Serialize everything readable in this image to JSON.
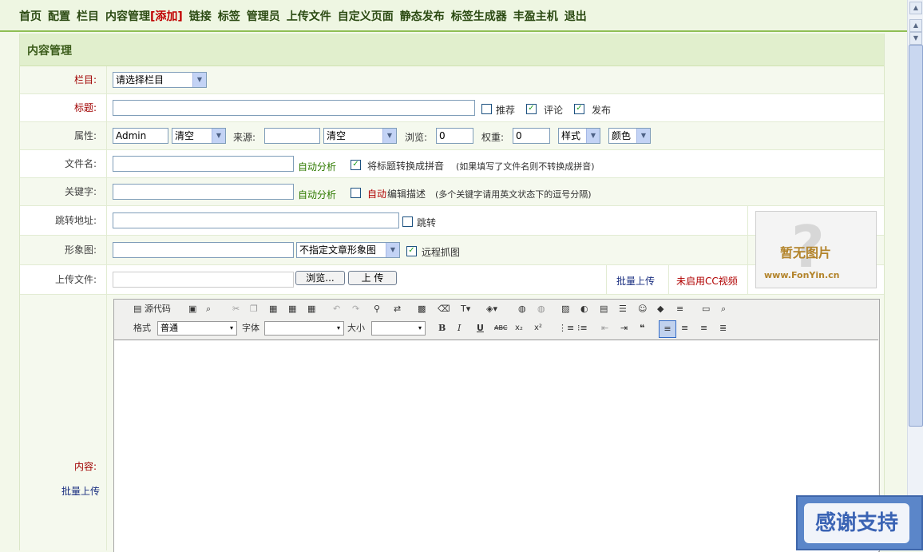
{
  "nav": {
    "items": [
      "首页",
      "配置",
      "栏目",
      "内容管理"
    ],
    "add": "[添加]",
    "items2": [
      "链接",
      "标签",
      "管理员",
      "上传文件",
      "自定义页面",
      "静态发布",
      "标签生成器",
      "丰盈主机",
      "退出"
    ]
  },
  "panel": {
    "title": "内容管理"
  },
  "form": {
    "column": {
      "label": "栏目:",
      "select": "请选择栏目"
    },
    "title": {
      "label": "标题:",
      "value": "",
      "opt_recommend": "推荐",
      "opt_comment": "评论",
      "opt_publish": "发布",
      "recommend_checked": false,
      "comment_checked": true,
      "publish_checked": true
    },
    "attr": {
      "label": "属性:",
      "author": "Admin",
      "author_clear": "清空",
      "source_label": "来源:",
      "source": "",
      "source_clear": "清空",
      "views_label": "浏览:",
      "views": "0",
      "weight_label": "权重:",
      "weight": "0",
      "style": "样式",
      "color": "颜色"
    },
    "filename": {
      "label": "文件名:",
      "auto": "自动分析",
      "pinyin": "将标题转换成拼音",
      "note": "(如果填写了文件名则不转换成拼音)",
      "pinyin_checked": true
    },
    "keywords": {
      "label": "关键字:",
      "auto": "自动分析",
      "auto_red": "自动",
      "desc": "编辑描述",
      "note": "(多个关键字请用英文状态下的逗号分隔)",
      "desc_checked": false
    },
    "redirect": {
      "label": "跳转地址:",
      "opt": "跳转",
      "checked": false
    },
    "image": {
      "label": "形象图:",
      "select": "不指定文章形象图",
      "remote": "远程抓图",
      "remote_checked": true,
      "noimg_title": "暂无图片",
      "noimg_site": "www.FonYin.cn"
    },
    "upload": {
      "label": "上传文件:",
      "browse": "浏览...",
      "upload_btn": "上 传",
      "batch": "批量上传",
      "cc": "未启用CC视频"
    },
    "content": {
      "label": "内容:",
      "batch": "批量上传"
    }
  },
  "editor": {
    "source": "源代码",
    "format_label": "格式",
    "format_value": "普通",
    "font_label": "字体",
    "size_label": "大小"
  },
  "thanks": "感谢支持"
}
